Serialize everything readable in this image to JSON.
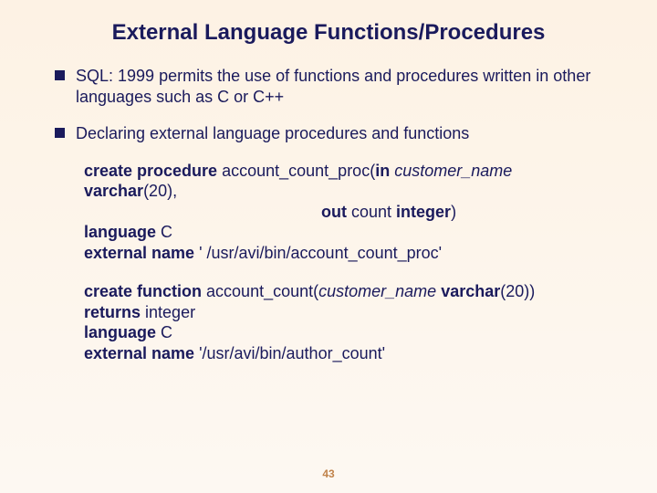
{
  "title": "External Language Functions/Procedures",
  "bullets": {
    "b1": "SQL: 1999 permits the use of functions and procedures written in other languages such as C or C++",
    "b2": "Declaring external language procedures and functions"
  },
  "proc": {
    "l1a": "create procedure ",
    "l1b": "account_count_proc(",
    "l1c": "in ",
    "l1d": "customer_name ",
    "l1e": "varchar",
    "l1f": "(20),",
    "l2a": "out ",
    "l2b": "count ",
    "l2c": "integer",
    "l2d": ")",
    "l3a": "language ",
    "l3b": "C",
    "l4a": "external name ",
    "l4b": "' /usr/avi/bin/account_count_proc'"
  },
  "func": {
    "l1a": "create function ",
    "l1b": "account_count(",
    "l1c": "customer_name ",
    "l1d": "varchar",
    "l1e": "(20))",
    "l2a": "returns ",
    "l2b": "integer",
    "l3a": "language ",
    "l3b": "C",
    "l4a": "external name ",
    "l4b": "'/usr/avi/bin/author_count'"
  },
  "page": "43"
}
